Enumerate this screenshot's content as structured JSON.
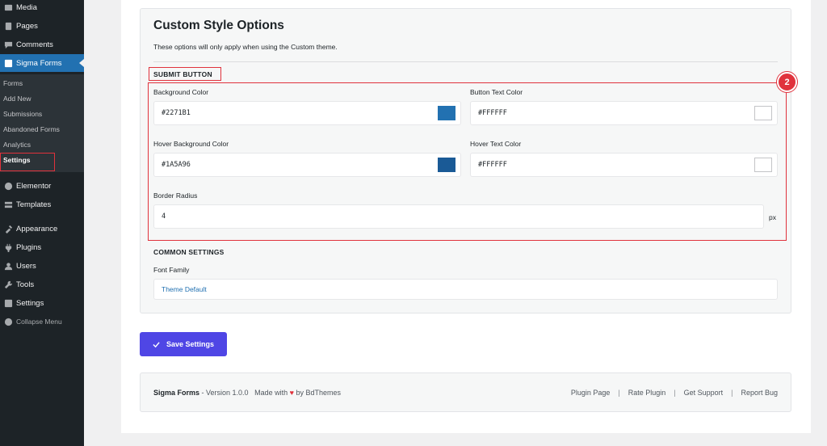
{
  "sidebar": {
    "items": [
      {
        "label": "Media",
        "icon": "media-icon"
      },
      {
        "label": "Pages",
        "icon": "pages-icon"
      },
      {
        "label": "Comments",
        "icon": "comments-icon"
      },
      {
        "label": "Sigma Forms",
        "icon": "sigma-forms-icon"
      },
      {
        "label": "Elementor",
        "icon": "elementor-icon"
      },
      {
        "label": "Templates",
        "icon": "templates-icon"
      },
      {
        "label": "Appearance",
        "icon": "appearance-icon"
      },
      {
        "label": "Plugins",
        "icon": "plugins-icon"
      },
      {
        "label": "Users",
        "icon": "users-icon"
      },
      {
        "label": "Tools",
        "icon": "tools-icon"
      },
      {
        "label": "Settings",
        "icon": "settings-icon"
      },
      {
        "label": "Collapse Menu",
        "icon": "collapse-icon"
      }
    ],
    "submenu": [
      "Forms",
      "Add New",
      "Submissions",
      "Abandoned Forms",
      "Analytics",
      "Settings"
    ]
  },
  "section": {
    "title": "Custom Style Options",
    "description": "These options will only apply when using the Custom theme.",
    "submit_heading": "SUBMIT BUTTON",
    "common_heading": "COMMON SETTINGS",
    "badge": "2"
  },
  "fields": {
    "bg_color": {
      "label": "Background Color",
      "value": "#2271B1",
      "swatch": "#2271b1"
    },
    "text_color": {
      "label": "Button Text Color",
      "value": "#FFFFFF",
      "swatch": "#ffffff"
    },
    "hover_bg": {
      "label": "Hover Background Color",
      "value": "#1A5A96",
      "swatch": "#1a5a96"
    },
    "hover_text": {
      "label": "Hover Text Color",
      "value": "#FFFFFF",
      "swatch": "#ffffff"
    },
    "border_radius": {
      "label": "Border Radius",
      "value": "4",
      "unit": "px"
    },
    "font_family": {
      "label": "Font Family",
      "value": "Theme Default"
    }
  },
  "actions": {
    "save": "Save Settings"
  },
  "footer": {
    "brand": "Sigma Forms",
    "version": " - Version 1.0.0",
    "made_with": "Made with",
    "heart": "♥",
    "by": "by BdThemes",
    "links": [
      "Plugin Page",
      "Rate Plugin",
      "Get Support",
      "Report Bug"
    ],
    "separator": "|"
  },
  "colors": {
    "accent": "#2271b1",
    "save_button": "#4f46e5",
    "highlight": "#e0323c"
  }
}
